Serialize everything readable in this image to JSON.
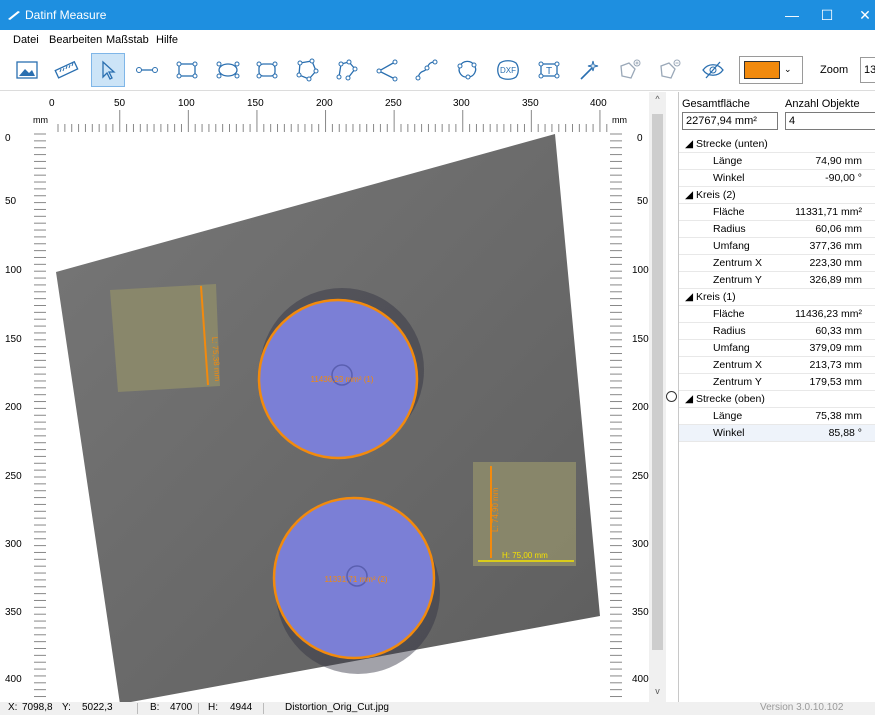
{
  "window": {
    "title": "Datinf Measure",
    "min_glyph": "—",
    "max_glyph": "☐",
    "close_glyph": "✕"
  },
  "menu": [
    "Datei",
    "Bearbeiten",
    "Maßstab",
    "Hilfe"
  ],
  "toolbar": {
    "tools": [
      {
        "name": "open-image-tool",
        "icon": "image-icon"
      },
      {
        "name": "scale-tool",
        "icon": "ruler-icon"
      },
      {
        "name": "select-tool",
        "icon": "cursor-icon",
        "active": true
      },
      {
        "name": "line-tool",
        "icon": "line-icon"
      },
      {
        "name": "rectangle-tool",
        "icon": "rectangle-icon"
      },
      {
        "name": "ellipse-tool",
        "icon": "ellipse-icon"
      },
      {
        "name": "rounded-rect-tool",
        "icon": "rounded-rect-icon"
      },
      {
        "name": "polygon-tool",
        "icon": "polygon-icon"
      },
      {
        "name": "polyline-tool",
        "icon": "polyline-icon"
      },
      {
        "name": "angle-tool",
        "icon": "angle-icon"
      },
      {
        "name": "curve-tool",
        "icon": "curve-icon"
      },
      {
        "name": "freeform-tool",
        "icon": "freeform-icon"
      },
      {
        "name": "dxf-import-tool",
        "icon": "dxf-icon",
        "label": "DXF"
      },
      {
        "name": "text-tool",
        "icon": "text-icon",
        "label": "T"
      },
      {
        "name": "magic-wand-tool",
        "icon": "magic-wand-icon"
      },
      {
        "name": "polygon-add-tool",
        "icon": "polygon-add-icon"
      },
      {
        "name": "polygon-subtract-tool",
        "icon": "polygon-subtract-icon"
      },
      {
        "name": "visibility-toggle",
        "icon": "eye-slash-icon"
      }
    ],
    "color_value": "#f28a0d",
    "color_chevron": "⌄",
    "zoom_label": "Zoom",
    "zoom_value": "13"
  },
  "canvas": {
    "ruler_unit": "mm",
    "top_ticks": [
      "0",
      "50",
      "100",
      "150",
      "200",
      "250",
      "300",
      "350",
      "400"
    ],
    "left_ticks": [
      "0",
      "50",
      "100",
      "150",
      "200",
      "250",
      "300",
      "350",
      "400"
    ],
    "circle1_label": "11436,23 mm² (1)",
    "circle2_label": "11331,71 mm² (2)",
    "strecke_oben_label": "L: 75,38 mm",
    "strecke_unten_label": "L: 74,90 mm",
    "strecke_h_label": "H: 75,00 mm",
    "colors": {
      "accent": "#f28a0d",
      "fill": "#7b7fd6",
      "dimension": "#f5e300"
    }
  },
  "scroll": {
    "up": "^",
    "down": "v"
  },
  "panel": {
    "header_total": "Gesamtfläche",
    "header_count": "Anzahl Objekte",
    "total_value": "22767,94 mm²",
    "count_value": "4",
    "groups": [
      {
        "label": "◢ Strecke (unten)",
        "props": [
          {
            "name": "Länge",
            "value": "74,90 mm"
          },
          {
            "name": "Winkel",
            "value": "-90,00 °"
          }
        ]
      },
      {
        "label": "◢ Kreis (2)",
        "props": [
          {
            "name": "Fläche",
            "value": "11331,71 mm²"
          },
          {
            "name": "Radius",
            "value": "60,06 mm"
          },
          {
            "name": "Umfang",
            "value": "377,36 mm"
          },
          {
            "name": "Zentrum X",
            "value": "223,30 mm"
          },
          {
            "name": "Zentrum Y",
            "value": "326,89 mm"
          }
        ]
      },
      {
        "label": "◢ Kreis (1)",
        "props": [
          {
            "name": "Fläche",
            "value": "11436,23 mm²"
          },
          {
            "name": "Radius",
            "value": "60,33 mm"
          },
          {
            "name": "Umfang",
            "value": "379,09 mm"
          },
          {
            "name": "Zentrum X",
            "value": "213,73 mm"
          },
          {
            "name": "Zentrum Y",
            "value": "179,53 mm"
          }
        ]
      },
      {
        "label": "◢ Strecke (oben)",
        "props": [
          {
            "name": "Länge",
            "value": "75,38 mm"
          },
          {
            "name": "Winkel",
            "value": "85,88 °"
          }
        ]
      }
    ]
  },
  "status": {
    "x_label": "X:",
    "x_value": "7098,8",
    "y_label": "Y:",
    "y_value": "5022,3",
    "b_label": "B:",
    "b_value": "4700",
    "h_label": "H:",
    "h_value": "4944",
    "filename": "Distortion_Orig_Cut.jpg",
    "version": "Version 3.0.10.102"
  }
}
